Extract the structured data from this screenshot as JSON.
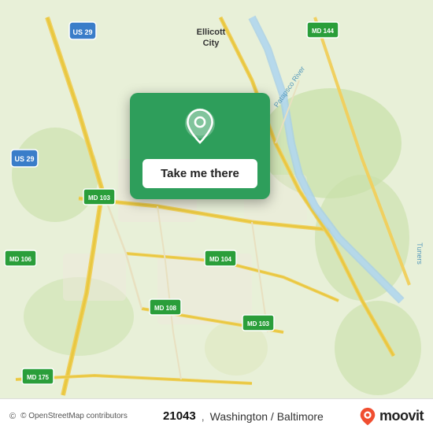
{
  "map": {
    "background_color": "#e8f0d8",
    "attribution": "© OpenStreetMap contributors"
  },
  "popup": {
    "button_label": "Take me there",
    "background_color": "#2e9e5b"
  },
  "bottom_bar": {
    "zip": "21043",
    "separator": ",",
    "location": "Washington / Baltimore",
    "brand": "moovit",
    "attribution": "© OpenStreetMap contributors"
  },
  "icons": {
    "pin": "location-pin-icon",
    "moovit_pin": "moovit-logo-icon",
    "copyright": "copyright-icon"
  }
}
